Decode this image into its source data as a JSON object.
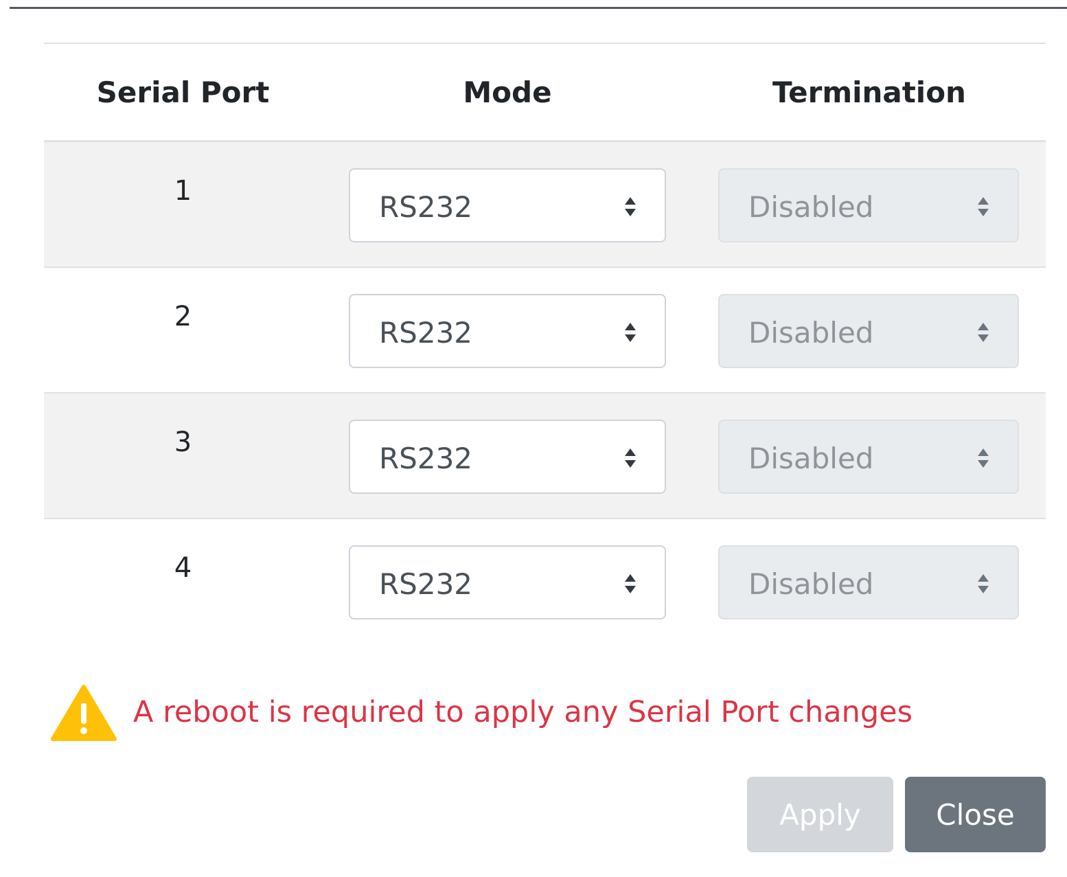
{
  "table": {
    "headers": {
      "port": "Serial Port",
      "mode": "Mode",
      "termination": "Termination"
    },
    "rows": [
      {
        "port": "1",
        "mode": "RS232",
        "termination": "Disabled"
      },
      {
        "port": "2",
        "mode": "RS232",
        "termination": "Disabled"
      },
      {
        "port": "3",
        "mode": "RS232",
        "termination": "Disabled"
      },
      {
        "port": "4",
        "mode": "RS232",
        "termination": "Disabled"
      }
    ]
  },
  "warning": {
    "icon": "warning-triangle-icon",
    "text": "A reboot is required to apply any Serial Port changes",
    "color": "#dc3545",
    "icon_color": "#ffc107"
  },
  "buttons": {
    "apply_label": "Apply",
    "apply_disabled": true,
    "close_label": "Close"
  }
}
